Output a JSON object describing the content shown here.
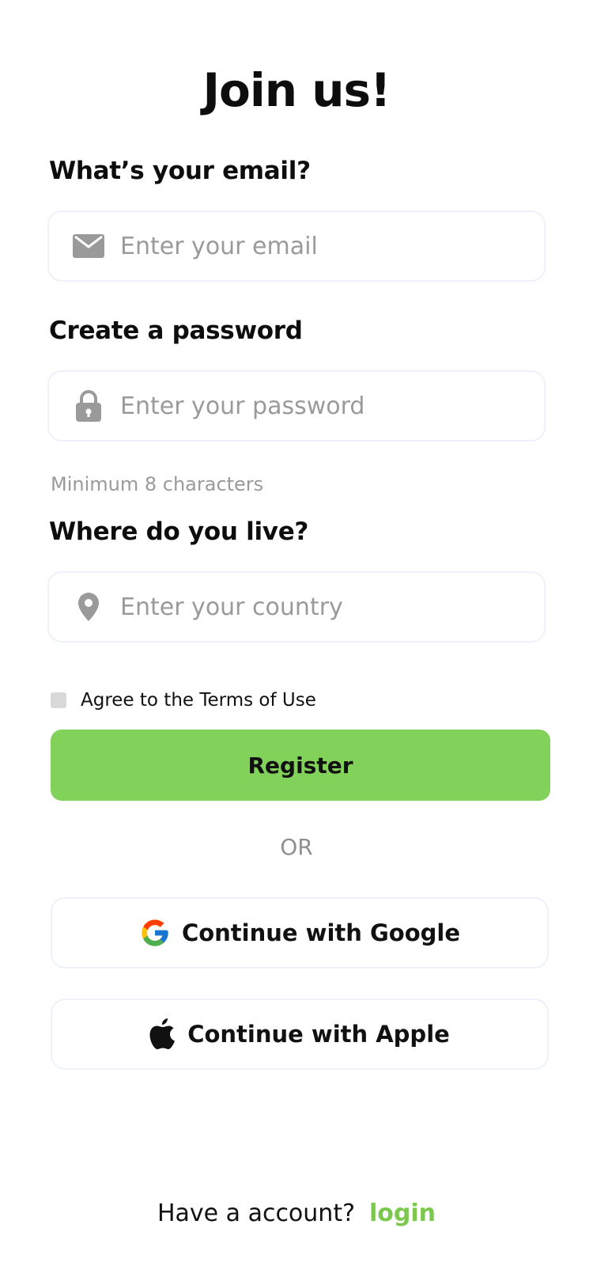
{
  "header": {
    "title": "Join us!"
  },
  "email": {
    "label": "What’s your email?",
    "placeholder": "Enter your email",
    "icon": "envelope-icon"
  },
  "password": {
    "label": "Create a password",
    "placeholder": "Enter your password",
    "hint": "Minimum 8 characters",
    "icon": "lock-icon"
  },
  "country": {
    "label": "Where do you live?",
    "placeholder": "Enter your country",
    "icon": "location-pin-icon"
  },
  "terms": {
    "label": "Agree to the Terms of Use",
    "checked": false
  },
  "register": {
    "label": "Register"
  },
  "divider": {
    "label": "OR"
  },
  "google": {
    "label": "Continue with Google",
    "icon": "google-icon"
  },
  "apple": {
    "label": "Continue with Apple",
    "icon": "apple-icon"
  },
  "footer": {
    "question": "Have a account?",
    "login_label": "login"
  },
  "colors": {
    "accent": "#82d15a",
    "link": "#7cc84f",
    "placeholder": "#9a9a9a",
    "field_border": "#eef0fa"
  }
}
